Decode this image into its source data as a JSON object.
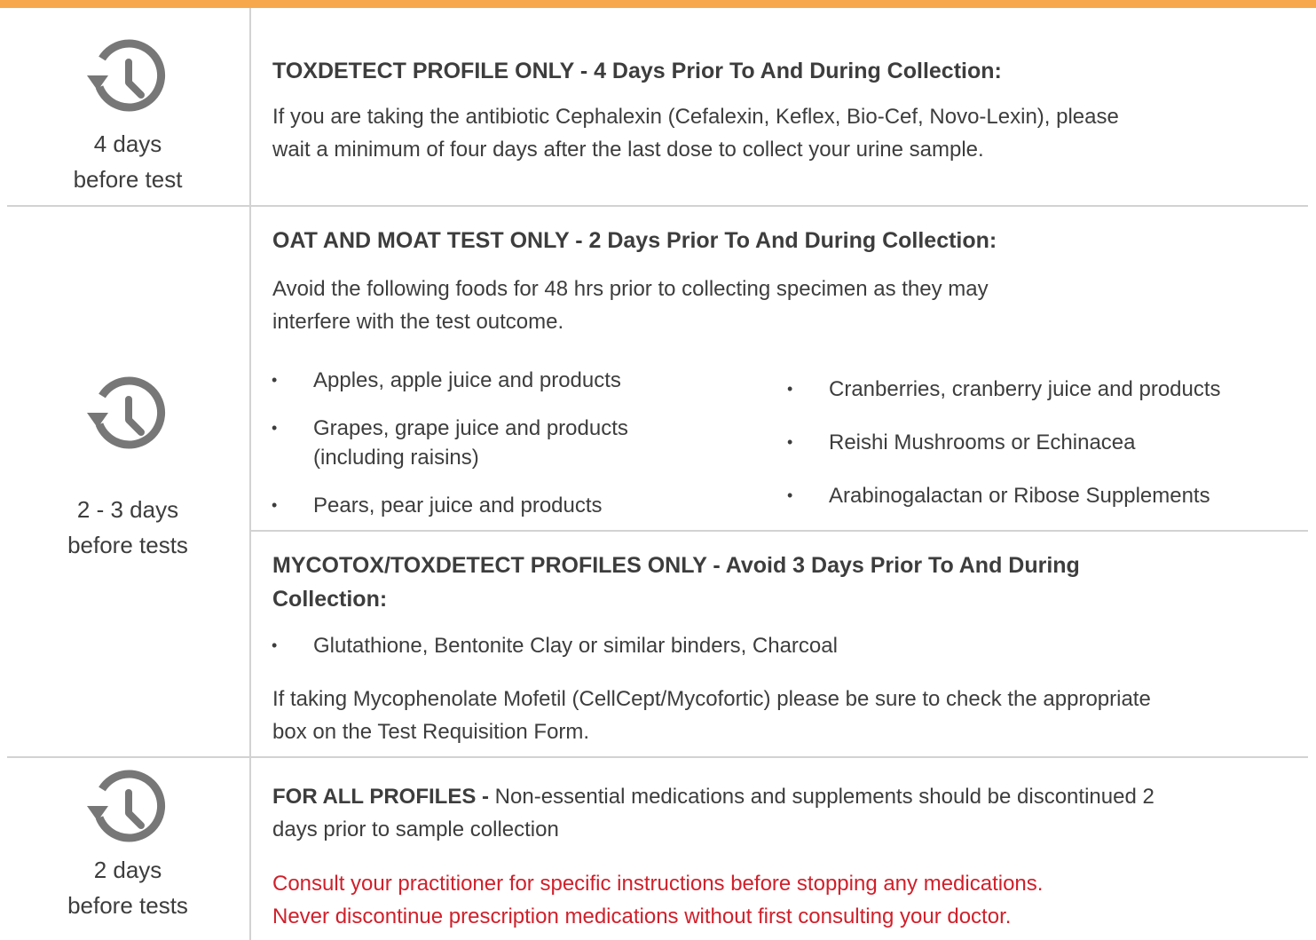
{
  "colors": {
    "accent_bar": "#f7a84a",
    "warning_text": "#d0202b",
    "divider": "#d2d2d2",
    "icon": "#777777"
  },
  "sections": [
    {
      "icon": "history-clock-icon",
      "days_line1": "4 days",
      "days_line2": "before test",
      "heading": "TOXDETECT PROFILE ONLY -  4 Days Prior To And During Collection:",
      "body_line1": "If you are taking the antibiotic Cephalexin (Cefalexin, Keflex, Bio-Cef, Novo-Lexin), please",
      "body_line2": "wait a minimum of four days after the last dose to collect your urine sample."
    },
    {
      "icon": "history-clock-icon",
      "days_line1": "2 - 3 days",
      "days_line2": "before tests",
      "heading": "OAT AND MOAT TEST ONLY -  2 Days Prior To And During Collection:",
      "body_line1": "Avoid the following foods for 48 hrs prior to collecting specimen as they may",
      "body_line2": "interfere with the test outcome.",
      "left_items": [
        "Apples, apple juice and products",
        "Grapes, grape juice and products",
        "(including raisins)",
        "Pears, pear juice and products"
      ],
      "right_items": [
        "Cranberries, cranberry juice and products",
        "Reishi Mushrooms or Echinacea",
        "Arabinogalactan or Ribose Supplements"
      ],
      "sub_heading_line1": "MYCOTOX/TOXDETECT PROFILES ONLY -  Avoid 3 Days Prior To And During",
      "sub_heading_line2": "Collection:",
      "sub_item": "Glutathione, Bentonite Clay or similar binders, Charcoal",
      "sub_body_line1": "If taking Mycophenolate Mofetil (CellCept/Mycofortic) please be sure to check the appropriate",
      "sub_body_line2": "box on the Test Requisition Form."
    },
    {
      "icon": "history-clock-icon",
      "days_line1": "2 days",
      "days_line2": "before tests",
      "heading_bold": "FOR ALL PROFILES -",
      "heading_rest": " Non-essential medications and supplements should be discontinued 2",
      "body_line2": "days prior to sample collection",
      "warning_line1": "Consult your practitioner for specific instructions before stopping any medications.",
      "warning_line2": "Never discontinue prescription medications without first consulting your doctor."
    }
  ]
}
